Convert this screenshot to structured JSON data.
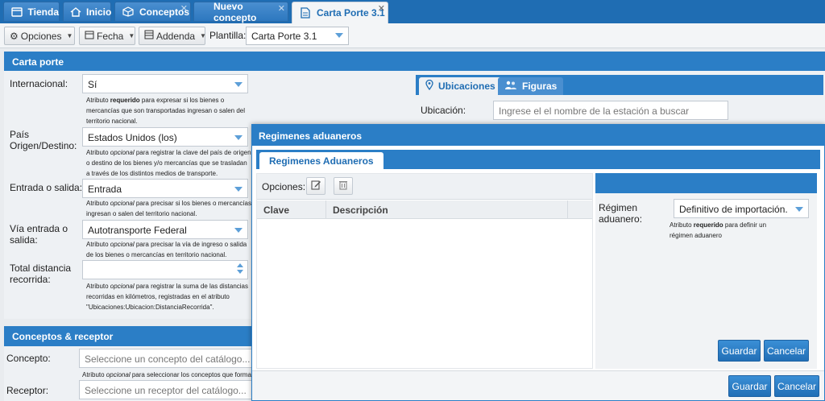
{
  "tabs": [
    {
      "label": "Tienda",
      "icon": "store-icon"
    },
    {
      "label": "Inicio",
      "icon": "home-icon"
    },
    {
      "label": "Conceptos",
      "icon": "box-icon"
    },
    {
      "label": "Nuevo concepto",
      "icon": ""
    },
    {
      "label": "Carta Porte 3.1",
      "icon": "document-icon"
    }
  ],
  "toolbar": {
    "opciones": "Opciones",
    "fecha": "Fecha",
    "addenda": "Addenda",
    "plantilla_label": "Plantilla:",
    "plantilla_value": "Carta Porte 3.1"
  },
  "carta_porte": {
    "title": "Carta porte",
    "internacional": {
      "label": "Internacional:",
      "value": "Sí",
      "help_pre": "Atributo ",
      "help_strong": "requerido",
      "help_post": " para expresar si los bienes o mercancías que son transportadas ingresan o salen del territorio nacional."
    },
    "pais": {
      "label": "País Origen/Destino:",
      "value": "Estados Unidos (los)",
      "help_pre": "Atributo ",
      "help_em": "opcional",
      "help_post": " para registrar la clave del país de origen o destino de los bienes y/o mercancías que se trasladan a través de los distintos medios de transporte."
    },
    "entrada_salida": {
      "label": "Entrada o salida:",
      "value": "Entrada",
      "help_pre": "Atributo ",
      "help_em": "opcional",
      "help_post": " para precisar si los bienes o mercancías ingresan o salen del territorio nacional."
    },
    "via": {
      "label": "Vía entrada o salida:",
      "value": "Autotransporte Federal",
      "help_pre": "Atributo ",
      "help_em": "opcional",
      "help_post": " para precisar la vía de ingreso o salida de los bienes o mercancías en territorio nacional."
    },
    "distancia": {
      "label": "Total distancia recorrida:",
      "value": "",
      "help_pre": "Atributo ",
      "help_em": "opcional",
      "help_post": " para registrar la suma de las distancias recorridas en kilómetros, registradas en el atributo \"Ubicaciones:Ubicacion:DistanciaRecorrida\"."
    }
  },
  "ubicaciones": {
    "tab_ubicaciones": "Ubicaciones",
    "tab_figuras": "Figuras",
    "ubicacion_label": "Ubicación:",
    "ubicacion_placeholder": "Ingrese el el nombre de la estación a buscar"
  },
  "conceptos": {
    "title": "Conceptos & receptor",
    "concepto_label": "Concepto:",
    "concepto_placeholder": "Seleccione un concepto del catálogo...",
    "concepto_help_pre": "Atributo ",
    "concepto_help_em": "opcional",
    "concepto_help_post": " para seleccionar los conceptos que formará",
    "receptor_label": "Receptor:",
    "receptor_placeholder": "Seleccione un receptor del catálogo..."
  },
  "modal": {
    "title": "Regimenes aduaneros",
    "tab": "Regimenes Aduaneros",
    "opciones_label": "Opciones:",
    "columns": [
      "Clave",
      "Descripción"
    ],
    "regimen_label": "Régimen aduanero:",
    "regimen_value": "Definitivo de importación.",
    "regimen_help_pre": "Atributo ",
    "regimen_help_strong": "requerido",
    "regimen_help_post": " para definir un régimen aduanero",
    "guardar": "Guardar",
    "cancelar": "Cancelar"
  },
  "colors": {
    "primary": "#2b7ec6",
    "tabbar": "#1f6db3"
  }
}
